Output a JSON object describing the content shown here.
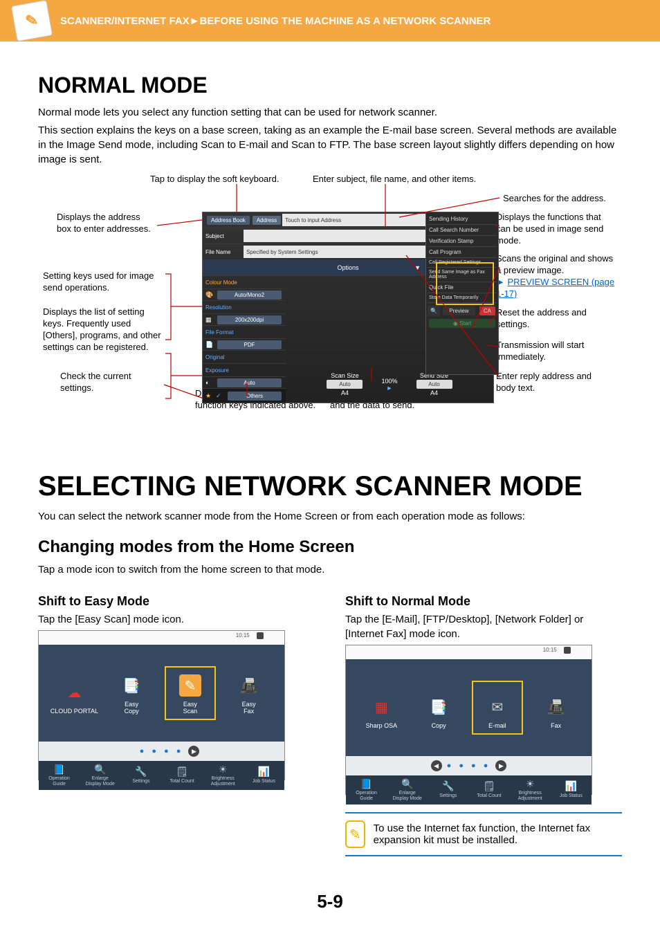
{
  "header": {
    "breadcrumb": "SCANNER/INTERNET FAX►BEFORE USING THE MACHINE AS A NETWORK SCANNER"
  },
  "normal_mode": {
    "title": "NORMAL MODE",
    "p1": "Normal mode lets you select any function setting that can be used for network scanner.",
    "p2": "This section explains the keys on a base screen, taking as an example the E-mail base screen. Several methods are available in the Image Send mode, including Scan to E-mail and Scan to FTP. The base screen layout slightly differs depending on how image is sent."
  },
  "diagram": {
    "cap_keyboard": "Tap to display the soft keyboard.",
    "cap_subject": "Enter subject, file name, and other items.",
    "left": {
      "address_box": "Displays the address box to enter addresses.",
      "setting_keys": "Setting keys used for image send operations.",
      "list_keys": "Displays the list of setting keys. Frequently used [Others], programs, and other settings can be registered.",
      "check": "Check the current settings."
    },
    "right": {
      "search": "Searches for the address.",
      "functions": "Displays the functions that can be used in image send mode.",
      "preview": "Scans the original and shows a preview image.",
      "preview_link": "PREVIEW SCREEN (page 1-17)",
      "reset": "Reset the address and settings.",
      "start": "Transmission will start immediately.",
      "reply": "Enter reply address and body text."
    },
    "bottom": {
      "other_keys": "Displays keys other than the function keys indicated above.",
      "sizes": "Displays the sizes of the original and the data to send."
    },
    "ui": {
      "address_book": "Address Book",
      "address_tab": "Address",
      "touch_input": "Touch to input Address",
      "subject": "Subject",
      "file_name": "File Name",
      "file_name_val": "Specified by System Settings",
      "options": "Options",
      "colour_mode": "Colour Mode",
      "colour_val": "Auto/Mono2",
      "resolution": "Resolution",
      "resolution_val": "200x200dpi",
      "file_format": "File Format",
      "file_format_val": "PDF",
      "original": "Original",
      "exposure": "Exposure",
      "exposure_val": "Auto",
      "others": "Others",
      "scan_size": "Scan Size",
      "scan_auto": "Auto",
      "scan_a4": "A4",
      "pct": "100%",
      "send_size": "Send Size",
      "send_auto": "Auto",
      "send_a4": "A4",
      "preview_btn": "Preview",
      "ca": "CA",
      "start_btn": "Start",
      "side": {
        "sending_history": "Sending History",
        "call_search": "Call Search Number",
        "verification": "Verification Stamp",
        "call_program": "Call Program",
        "call_registered": "Call Registered Settings",
        "send_same": "Send Same Image as Fax Address",
        "quick_file": "Quick File",
        "store_temp": "Store Data Temporarily"
      }
    }
  },
  "selecting": {
    "title": "SELECTING NETWORK SCANNER MODE",
    "p": "You can select the network scanner mode from the Home Screen or from each operation mode as follows:",
    "h2": "Changing modes from the Home Screen",
    "p2": "Tap a mode icon to switch from the home screen to that mode.",
    "easy": {
      "h": "Shift to Easy Mode",
      "p": "Tap the [Easy Scan] mode icon.",
      "tiles": [
        "CLOUD PORTAL",
        "Easy\nCopy",
        "Easy\nScan",
        "Easy\nFax"
      ]
    },
    "normal": {
      "h": "Shift to Normal Mode",
      "p": "Tap the [E-Mail], [FTP/Desktop], [Network Folder] or [Internet Fax] mode icon.",
      "tiles": [
        "Sharp OSA",
        "Copy",
        "E-mail",
        "Fax"
      ]
    },
    "time": "10:15",
    "bottom_items": [
      "Operation\nGuide",
      "Enlarge\nDisplay Mode",
      "Settings",
      "Total Count",
      "Brightness\nAdjustment",
      "Job Status"
    ],
    "note": "To use the Internet fax function, the Internet fax expansion kit must be installed."
  },
  "page_num": "5-9"
}
